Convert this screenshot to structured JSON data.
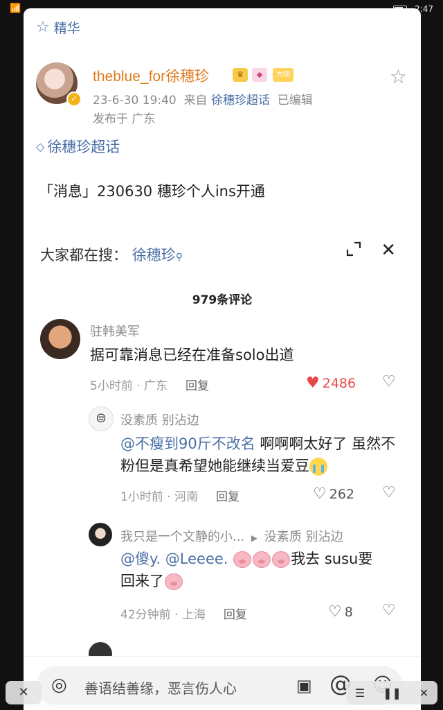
{
  "status": {
    "time": "2:47"
  },
  "header": {
    "essence_label": "精华"
  },
  "post": {
    "username": "theblue_for徐穗珍",
    "badge_vip": "大咖",
    "time": "23-6-30 19:40",
    "from_label": "来自",
    "source": "徐穗珍超话",
    "edited": "已编辑",
    "location_line": "发布于 广东",
    "topic": "徐穗珍超话",
    "text": "「消息」230630 穗珍个人ins开通"
  },
  "search": {
    "label": "大家都在搜：",
    "keyword": "徐穗珍"
  },
  "comments_count": "979条评论",
  "comments": [
    {
      "name": "驻韩美军",
      "text": "据可靠消息已经在准备solo出道",
      "time": "5小时前 · 广东",
      "reply": "回复",
      "likes": "2486"
    },
    {
      "name": "没素质 别沾边",
      "at": "@不瘦到90斤不改名",
      "text": " 啊啊啊太好了 虽然不粉但是真希望她能继续当爱豆",
      "time": "1小时前 · 河南",
      "reply": "回复",
      "likes": "262"
    },
    {
      "name": "我只是一个文静的小...",
      "reply_to": "没素质 别沾边",
      "at": "@傻y. @Leeee.",
      "text_a": "我去 susu要",
      "text_b": "回来了",
      "time": "42分钟前 · 上海",
      "reply": "回复",
      "likes": "8"
    }
  ],
  "input": {
    "placeholder": "善语结善缘，恶言伤人心"
  },
  "colors": {
    "link": "#4a6fa5",
    "username": "#e07b1e",
    "heart": "#e8484a"
  }
}
